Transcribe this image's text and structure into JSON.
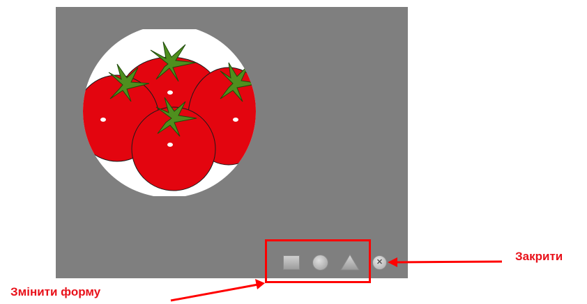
{
  "canvas": {
    "background": "#7f7f7f",
    "image": "tomatoes-clipart"
  },
  "shape_toolbar": {
    "buttons": [
      {
        "icon": "square-shape-icon"
      },
      {
        "icon": "circle-shape-icon"
      },
      {
        "icon": "triangle-shape-icon"
      }
    ],
    "close_icon_glyph": "✕"
  },
  "annotations": {
    "close_label": "Закрити",
    "change_shape_label": "Змінити форму",
    "accent_color": "#ff0000"
  }
}
